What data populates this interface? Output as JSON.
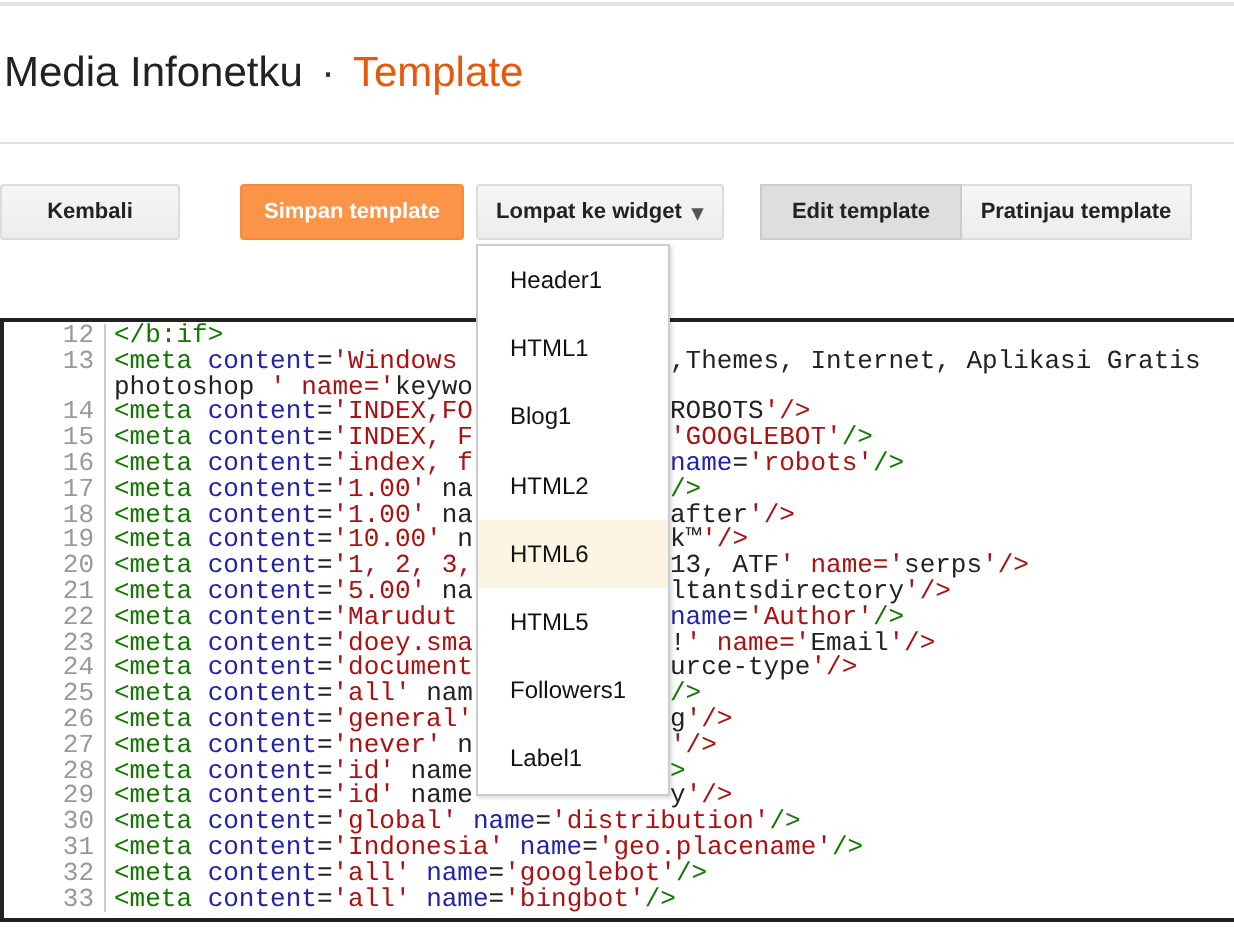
{
  "header": {
    "blog_title": "Media Infonetku",
    "separator": "·",
    "page_title": "Template"
  },
  "toolbar": {
    "back_button": "Kembali",
    "save_button": "Simpan template",
    "jump_dropdown": "Lompat ke widget",
    "jump_caret": "▾",
    "mode_tabs": [
      {
        "label": "Edit template",
        "selected": true
      },
      {
        "label": "Pratinjau template",
        "selected": false
      }
    ]
  },
  "jump_menu": {
    "items": [
      {
        "label": "Header1",
        "selected": false
      },
      {
        "label": "HTML1",
        "selected": false
      },
      {
        "label": "Blog1",
        "selected": false
      },
      {
        "label": "HTML2",
        "selected": false
      },
      {
        "label": "HTML6",
        "selected": true
      },
      {
        "label": "HTML5",
        "selected": false
      },
      {
        "label": "Followers1",
        "selected": false
      },
      {
        "label": "Label1",
        "selected": false
      }
    ]
  },
  "editor": {
    "lines": [
      {
        "number": "12",
        "left": "</b:if>"
      },
      {
        "number": "13",
        "left": "<meta content='Windows",
        "right": ",Themes, Internet, Aplikasi Gratis"
      },
      {
        "left": "photoshop ' name='keywo"
      },
      {
        "number": "14",
        "left": "<meta content='INDEX,FO",
        "right": "ROBOTS'/>"
      },
      {
        "number": "15",
        "left": "<meta content='INDEX, F",
        "right": "'GOOGLEBOT'/>"
      },
      {
        "number": "16",
        "left": "<meta content='index, f",
        "right": "name='robots'/>"
      },
      {
        "number": "17",
        "left": "<meta content='1.00' na",
        "right": "/>"
      },
      {
        "number": "18",
        "left": "<meta content='1.00' na",
        "right": "after'/>"
      },
      {
        "number": "19",
        "left": "<meta content='10.00' n",
        "right": "k™'/>"
      },
      {
        "number": "20",
        "left": "<meta content='1, 2, 3,",
        "right": "13, ATF' name='serps'/>"
      },
      {
        "number": "21",
        "left": "<meta content='5.00' na",
        "right": "ltantsdirectory'/>"
      },
      {
        "number": "22",
        "left": "<meta content='Marudut",
        "right": "name='Author'/>"
      },
      {
        "number": "23",
        "left": "<meta content='doey.sma",
        "right": "!' name='Email'/>"
      },
      {
        "number": "24",
        "left": "<meta content='document",
        "right": "urce-type'/>"
      },
      {
        "number": "25",
        "left": "<meta content='all' nam",
        "right": "/>"
      },
      {
        "number": "26",
        "left": "<meta content='general'",
        "right": "g'/>"
      },
      {
        "number": "27",
        "left": "<meta content='never' n",
        "right": "'/>"
      },
      {
        "number": "28",
        "left": "<meta content='id' name",
        "right": ">"
      },
      {
        "number": "29",
        "left": "<meta content='id' name",
        "right": "y'/>"
      },
      {
        "number": "30",
        "left": "<meta content='global' name='distribution'/>"
      },
      {
        "number": "31",
        "left": "<meta content='Indonesia' name='geo.placename'/>"
      },
      {
        "number": "32",
        "left": "<meta content='all' name='googlebot'/>"
      },
      {
        "number": "33",
        "left": "<meta content='all' name='bingbot'/>"
      }
    ]
  }
}
